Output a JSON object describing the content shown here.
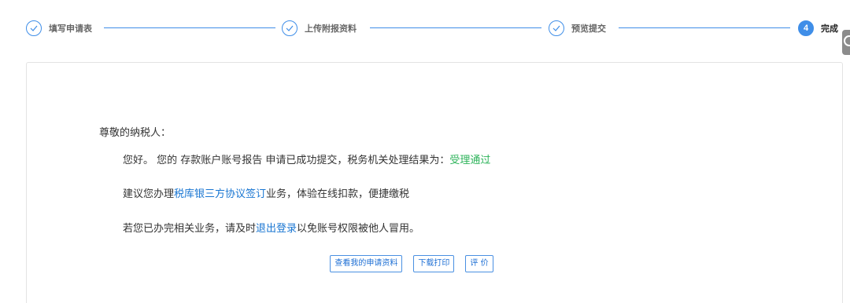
{
  "stepper": {
    "steps": [
      {
        "label": "填写申请表",
        "status": "done"
      },
      {
        "label": "上传附报资料",
        "status": "done"
      },
      {
        "label": "预览提交",
        "status": "done"
      },
      {
        "label": "完成",
        "number": "4",
        "status": "current"
      }
    ],
    "accent_color": "#3f8ee8"
  },
  "result": {
    "greeting": "尊敬的纳税人：",
    "line1_prefix": "您好。 您的 存款账户账号报告 申请已成功提交，税务机关处理结果为：",
    "line1_status": "受理通过",
    "line2_prefix": "建议您办理",
    "line2_link": "税库银三方协议签订",
    "line2_suffix": "业务，体验在线扣款，便捷缴税",
    "line3_prefix": "若您已办完相关业务，请及时",
    "line3_link": "退出登录",
    "line3_suffix": "以免账号权限被他人冒用。",
    "status_color": "#2db35a",
    "link_color": "#1976d2"
  },
  "actions": {
    "view_label": "查看我的申请资料",
    "download_label": "下载打印",
    "rate_label": "评 价"
  },
  "icons": {
    "done_step": "check-circle-icon",
    "side_tab": "circle-icon"
  }
}
